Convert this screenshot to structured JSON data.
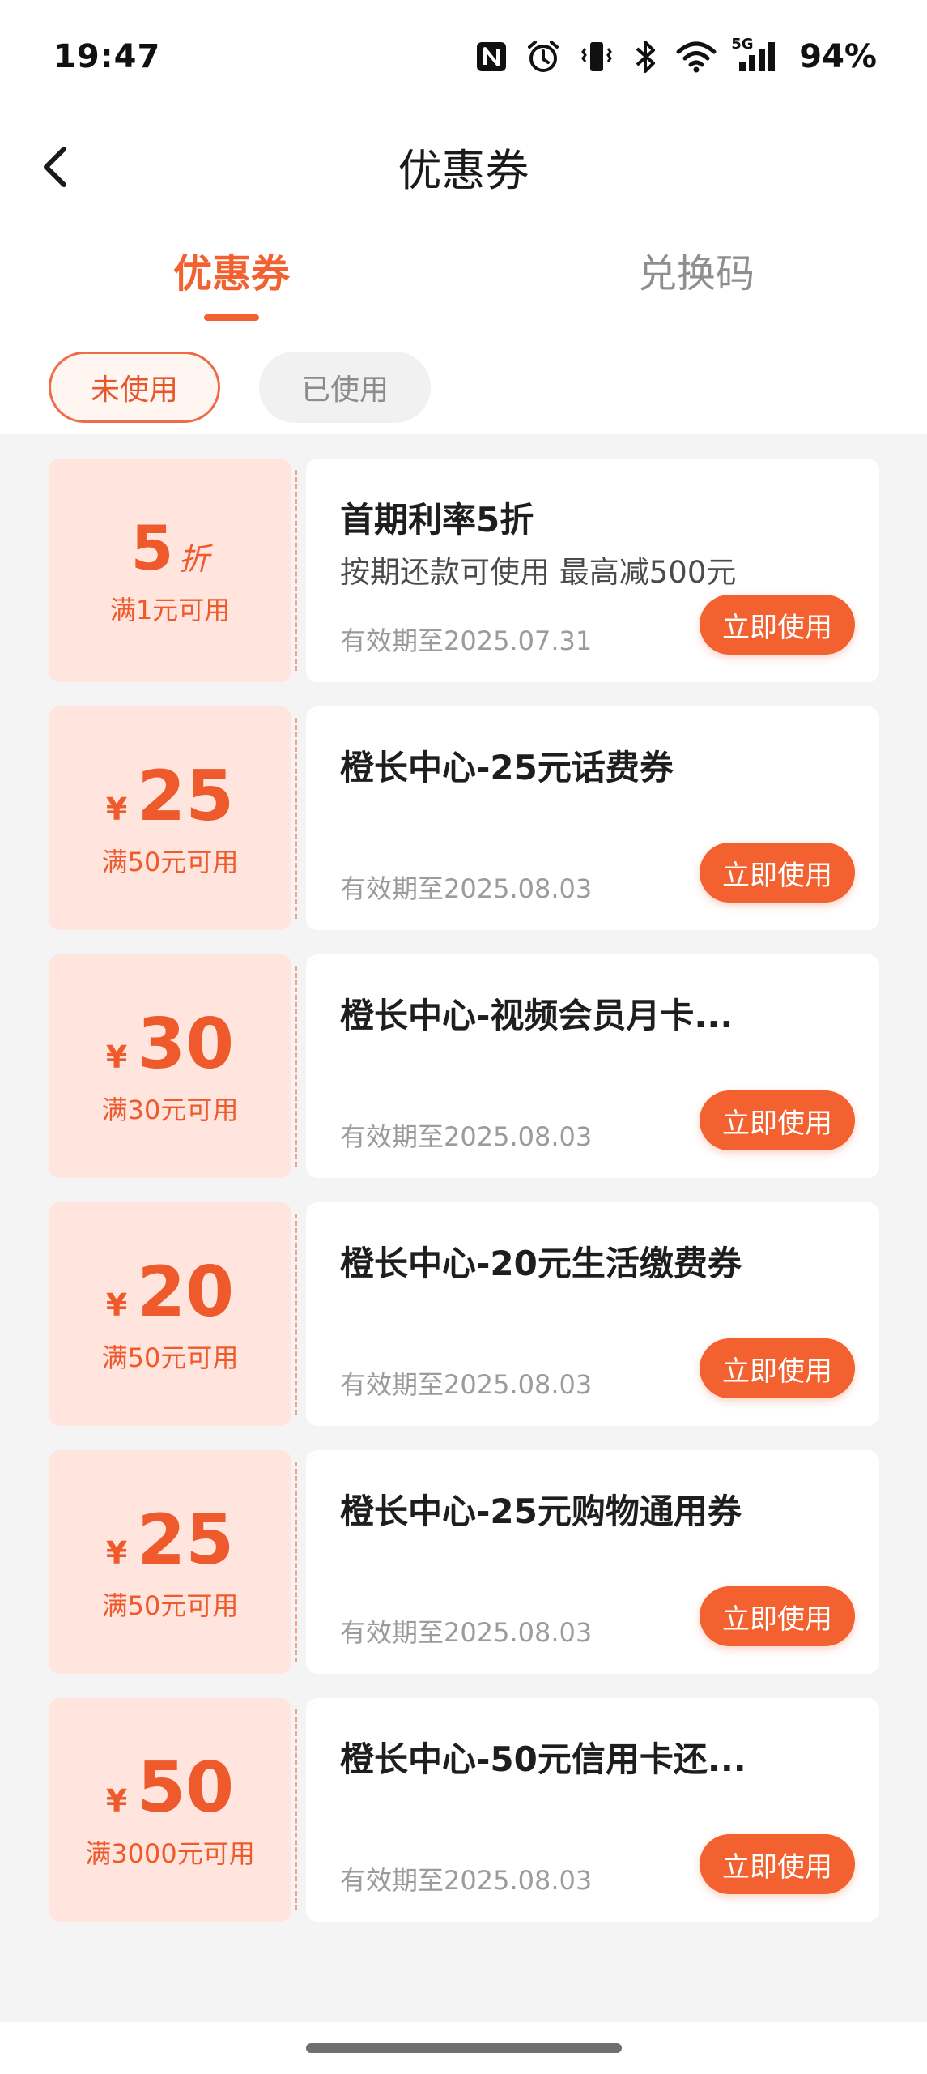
{
  "status_bar": {
    "time": "19:47",
    "icons": [
      "nfc-icon",
      "alarm-icon",
      "vibrate-icon",
      "bluetooth-icon",
      "wifi-icon",
      "5g-signal-icon"
    ],
    "network_label": "5G",
    "battery": "94%"
  },
  "nav": {
    "back_icon": "chevron-left-icon",
    "title": "优惠券"
  },
  "tabs": [
    {
      "label": "优惠券",
      "active": true
    },
    {
      "label": "兑换码",
      "active": false
    }
  ],
  "filters": [
    {
      "label": "未使用",
      "active": true
    },
    {
      "label": "已使用",
      "active": false
    }
  ],
  "colors": {
    "accent": "#f2612f",
    "coupon_left_bg": "#ffe5de",
    "list_bg": "#f4f4f4"
  },
  "coupons": [
    {
      "kind": "discount",
      "amount": "5",
      "unit": "折",
      "min_spend": "满1元可用",
      "title": "首期利率5折",
      "desc": "按期还款可使用 最高减500元",
      "expiry": "有效期至2025.07.31",
      "button": "立即使用"
    },
    {
      "kind": "cash",
      "symbol": "¥",
      "amount": "25",
      "min_spend": "满50元可用",
      "title": "橙长中心-25元话费券",
      "desc": "",
      "expiry": "有效期至2025.08.03",
      "button": "立即使用"
    },
    {
      "kind": "cash",
      "symbol": "¥",
      "amount": "30",
      "min_spend": "满30元可用",
      "title": "橙长中心-视频会员月卡...",
      "desc": "",
      "expiry": "有效期至2025.08.03",
      "button": "立即使用"
    },
    {
      "kind": "cash",
      "symbol": "¥",
      "amount": "20",
      "min_spend": "满50元可用",
      "title": "橙长中心-20元生活缴费券",
      "desc": "",
      "expiry": "有效期至2025.08.03",
      "button": "立即使用"
    },
    {
      "kind": "cash",
      "symbol": "¥",
      "amount": "25",
      "min_spend": "满50元可用",
      "title": "橙长中心-25元购物通用券",
      "desc": "",
      "expiry": "有效期至2025.08.03",
      "button": "立即使用"
    },
    {
      "kind": "cash",
      "symbol": "¥",
      "amount": "50",
      "min_spend": "满3000元可用",
      "title": "橙长中心-50元信用卡还...",
      "desc": "",
      "expiry": "有效期至2025.08.03",
      "button": "立即使用"
    }
  ]
}
